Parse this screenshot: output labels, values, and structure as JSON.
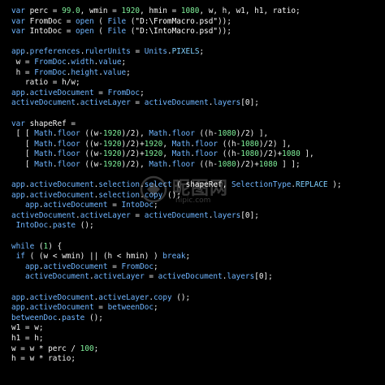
{
  "colors": {
    "background": "#000000",
    "keyword": "#6fb5ff",
    "identifier": "#f2f2f2",
    "number": "#7ff09a",
    "string": "#ffffff",
    "object": "#6fb5ff",
    "constant": "#7fd0ff"
  },
  "watermark": {
    "icon": "watermark-logo-icon",
    "text": "昵图网",
    "sub": "nipic.com"
  },
  "code_lines": [
    [
      [
        "kw",
        "var"
      ],
      [
        "t",
        " perc = "
      ],
      [
        "n",
        "99.0"
      ],
      [
        "t",
        ", wmin = "
      ],
      [
        "n",
        "1920"
      ],
      [
        "t",
        ", hmin = "
      ],
      [
        "n",
        "1080"
      ],
      [
        "t",
        ", w, h, w1, h1, ratio;"
      ]
    ],
    [
      [
        "kw",
        "var"
      ],
      [
        "t",
        " FromDoc = "
      ],
      [
        "kw",
        "open"
      ],
      [
        "t",
        " ( "
      ],
      [
        "kw",
        "File"
      ],
      [
        "t",
        " ("
      ],
      [
        "s",
        "\"D:\\FromMacro.psd\""
      ],
      [
        "t",
        "));"
      ]
    ],
    [
      [
        "kw",
        "var"
      ],
      [
        "t",
        " IntoDoc = "
      ],
      [
        "kw",
        "open"
      ],
      [
        "t",
        " ( "
      ],
      [
        "kw",
        "File"
      ],
      [
        "t",
        " ("
      ],
      [
        "s",
        "\"D:\\IntoMacro.psd\""
      ],
      [
        "t",
        "));"
      ]
    ],
    [],
    [
      [
        "o",
        "app"
      ],
      [
        "t",
        "."
      ],
      [
        "p",
        "preferences"
      ],
      [
        "t",
        "."
      ],
      [
        "p",
        "rulerUnits"
      ],
      [
        "t",
        " = "
      ],
      [
        "o",
        "Units"
      ],
      [
        "t",
        "."
      ],
      [
        "c",
        "PIXELS"
      ],
      [
        "t",
        ";"
      ]
    ],
    [
      [
        "t",
        " w = "
      ],
      [
        "o",
        "FromDoc"
      ],
      [
        "t",
        "."
      ],
      [
        "p",
        "width"
      ],
      [
        "t",
        "."
      ],
      [
        "p",
        "value"
      ],
      [
        "t",
        ";"
      ]
    ],
    [
      [
        "t",
        " h = "
      ],
      [
        "o",
        "FromDoc"
      ],
      [
        "t",
        "."
      ],
      [
        "p",
        "height"
      ],
      [
        "t",
        "."
      ],
      [
        "p",
        "value"
      ],
      [
        "t",
        ";"
      ]
    ],
    [
      [
        "t",
        "   ratio = h/w;"
      ]
    ],
    [
      [
        "o",
        "app"
      ],
      [
        "t",
        "."
      ],
      [
        "p",
        "activeDocument"
      ],
      [
        "t",
        " = "
      ],
      [
        "o",
        "FromDoc"
      ],
      [
        "t",
        ";"
      ]
    ],
    [
      [
        "o",
        "activeDocument"
      ],
      [
        "t",
        "."
      ],
      [
        "p",
        "activeLayer"
      ],
      [
        "t",
        " = "
      ],
      [
        "o",
        "activeDocument"
      ],
      [
        "t",
        "."
      ],
      [
        "p",
        "layers"
      ],
      [
        "t",
        "[0];"
      ]
    ],
    [],
    [
      [
        "kw",
        "var"
      ],
      [
        "t",
        " shapeRef ="
      ]
    ],
    [
      [
        "t",
        " [ [ "
      ],
      [
        "o",
        "Math"
      ],
      [
        "t",
        "."
      ],
      [
        "p",
        "floor"
      ],
      [
        "t",
        " ((w-"
      ],
      [
        "n",
        "1920"
      ],
      [
        "t",
        ")/2), "
      ],
      [
        "o",
        "Math"
      ],
      [
        "t",
        "."
      ],
      [
        "p",
        "floor"
      ],
      [
        "t",
        " ((h-"
      ],
      [
        "n",
        "1080"
      ],
      [
        "t",
        ")/2) ],"
      ]
    ],
    [
      [
        "t",
        "   [ "
      ],
      [
        "o",
        "Math"
      ],
      [
        "t",
        "."
      ],
      [
        "p",
        "floor"
      ],
      [
        "t",
        " ((w-"
      ],
      [
        "n",
        "1920"
      ],
      [
        "t",
        ")/2)+"
      ],
      [
        "n",
        "1920"
      ],
      [
        "t",
        ", "
      ],
      [
        "o",
        "Math"
      ],
      [
        "t",
        "."
      ],
      [
        "p",
        "floor"
      ],
      [
        "t",
        " ((h-"
      ],
      [
        "n",
        "1080"
      ],
      [
        "t",
        ")/2) ],"
      ]
    ],
    [
      [
        "t",
        "   [ "
      ],
      [
        "o",
        "Math"
      ],
      [
        "t",
        "."
      ],
      [
        "p",
        "floor"
      ],
      [
        "t",
        " ((w-"
      ],
      [
        "n",
        "1920"
      ],
      [
        "t",
        ")/2)+"
      ],
      [
        "n",
        "1920"
      ],
      [
        "t",
        ", "
      ],
      [
        "o",
        "Math"
      ],
      [
        "t",
        "."
      ],
      [
        "p",
        "floor"
      ],
      [
        "t",
        " ((h-"
      ],
      [
        "n",
        "1080"
      ],
      [
        "t",
        ")/2)+"
      ],
      [
        "n",
        "1080"
      ],
      [
        "t",
        " ],"
      ]
    ],
    [
      [
        "t",
        "   [ "
      ],
      [
        "o",
        "Math"
      ],
      [
        "t",
        "."
      ],
      [
        "p",
        "floor"
      ],
      [
        "t",
        " ((w-"
      ],
      [
        "n",
        "1920"
      ],
      [
        "t",
        ")/2), "
      ],
      [
        "o",
        "Math"
      ],
      [
        "t",
        "."
      ],
      [
        "p",
        "floor"
      ],
      [
        "t",
        " ((h-"
      ],
      [
        "n",
        "1080"
      ],
      [
        "t",
        ")/2)+"
      ],
      [
        "n",
        "1080"
      ],
      [
        "t",
        " ] ];"
      ]
    ],
    [],
    [
      [
        "o",
        "app"
      ],
      [
        "t",
        "."
      ],
      [
        "p",
        "activeDocument"
      ],
      [
        "t",
        "."
      ],
      [
        "p",
        "selection"
      ],
      [
        "t",
        "."
      ],
      [
        "p",
        "select"
      ],
      [
        "t",
        " ( "
      ],
      [
        "t",
        "shapeRef"
      ],
      [
        "t",
        ", "
      ],
      [
        "o",
        "SelectionType"
      ],
      [
        "t",
        "."
      ],
      [
        "c",
        "REPLACE"
      ],
      [
        "t",
        " );"
      ]
    ],
    [
      [
        "o",
        "app"
      ],
      [
        "t",
        "."
      ],
      [
        "p",
        "activeDocument"
      ],
      [
        "t",
        "."
      ],
      [
        "p",
        "selection"
      ],
      [
        "t",
        "."
      ],
      [
        "p",
        "copy"
      ],
      [
        "t",
        " ();"
      ]
    ],
    [
      [
        "t",
        "   "
      ],
      [
        "o",
        "app"
      ],
      [
        "t",
        "."
      ],
      [
        "p",
        "activeDocument"
      ],
      [
        "t",
        " = "
      ],
      [
        "o",
        "IntoDoc"
      ],
      [
        "t",
        ";"
      ]
    ],
    [
      [
        "o",
        "activeDocument"
      ],
      [
        "t",
        "."
      ],
      [
        "p",
        "activeLayer"
      ],
      [
        "t",
        " = "
      ],
      [
        "o",
        "activeDocument"
      ],
      [
        "t",
        "."
      ],
      [
        "p",
        "layers"
      ],
      [
        "t",
        "[0];"
      ]
    ],
    [
      [
        "t",
        " "
      ],
      [
        "o",
        "IntoDoc"
      ],
      [
        "t",
        "."
      ],
      [
        "p",
        "paste"
      ],
      [
        "t",
        " ();"
      ]
    ],
    [],
    [
      [
        "kw",
        "while"
      ],
      [
        "t",
        " ("
      ],
      [
        "n",
        "1"
      ],
      [
        "t",
        ") {"
      ]
    ],
    [
      [
        "t",
        " "
      ],
      [
        "kw",
        "if"
      ],
      [
        "t",
        " ( (w < wmin) || (h < hmin) ) "
      ],
      [
        "kw",
        "break"
      ],
      [
        "t",
        ";"
      ]
    ],
    [
      [
        "t",
        "   "
      ],
      [
        "o",
        "app"
      ],
      [
        "t",
        "."
      ],
      [
        "p",
        "activeDocument"
      ],
      [
        "t",
        " = "
      ],
      [
        "o",
        "FromDoc"
      ],
      [
        "t",
        ";"
      ]
    ],
    [
      [
        "t",
        "   "
      ],
      [
        "o",
        "activeDocument"
      ],
      [
        "t",
        "."
      ],
      [
        "p",
        "activeLayer"
      ],
      [
        "t",
        " = "
      ],
      [
        "o",
        "activeDocument"
      ],
      [
        "t",
        "."
      ],
      [
        "p",
        "layers"
      ],
      [
        "t",
        "[0];"
      ]
    ],
    [],
    [
      [
        "o",
        "app"
      ],
      [
        "t",
        "."
      ],
      [
        "p",
        "activeDocument"
      ],
      [
        "t",
        "."
      ],
      [
        "p",
        "activeLayer"
      ],
      [
        "t",
        "."
      ],
      [
        "p",
        "copy"
      ],
      [
        "t",
        " ();"
      ]
    ],
    [
      [
        "o",
        "app"
      ],
      [
        "t",
        "."
      ],
      [
        "p",
        "activeDocument"
      ],
      [
        "t",
        " = "
      ],
      [
        "o",
        "betweenDoc"
      ],
      [
        "t",
        ";"
      ]
    ],
    [
      [
        "o",
        "betweenDoc"
      ],
      [
        "t",
        "."
      ],
      [
        "p",
        "paste"
      ],
      [
        "t",
        " ();"
      ]
    ],
    [
      [
        "t",
        "w1 = w;"
      ]
    ],
    [
      [
        "t",
        "h1 = h;"
      ]
    ],
    [
      [
        "t",
        "w = w * perc / "
      ],
      [
        "n",
        "100"
      ],
      [
        "t",
        ";"
      ]
    ],
    [
      [
        "t",
        "h = w * ratio;"
      ]
    ]
  ]
}
